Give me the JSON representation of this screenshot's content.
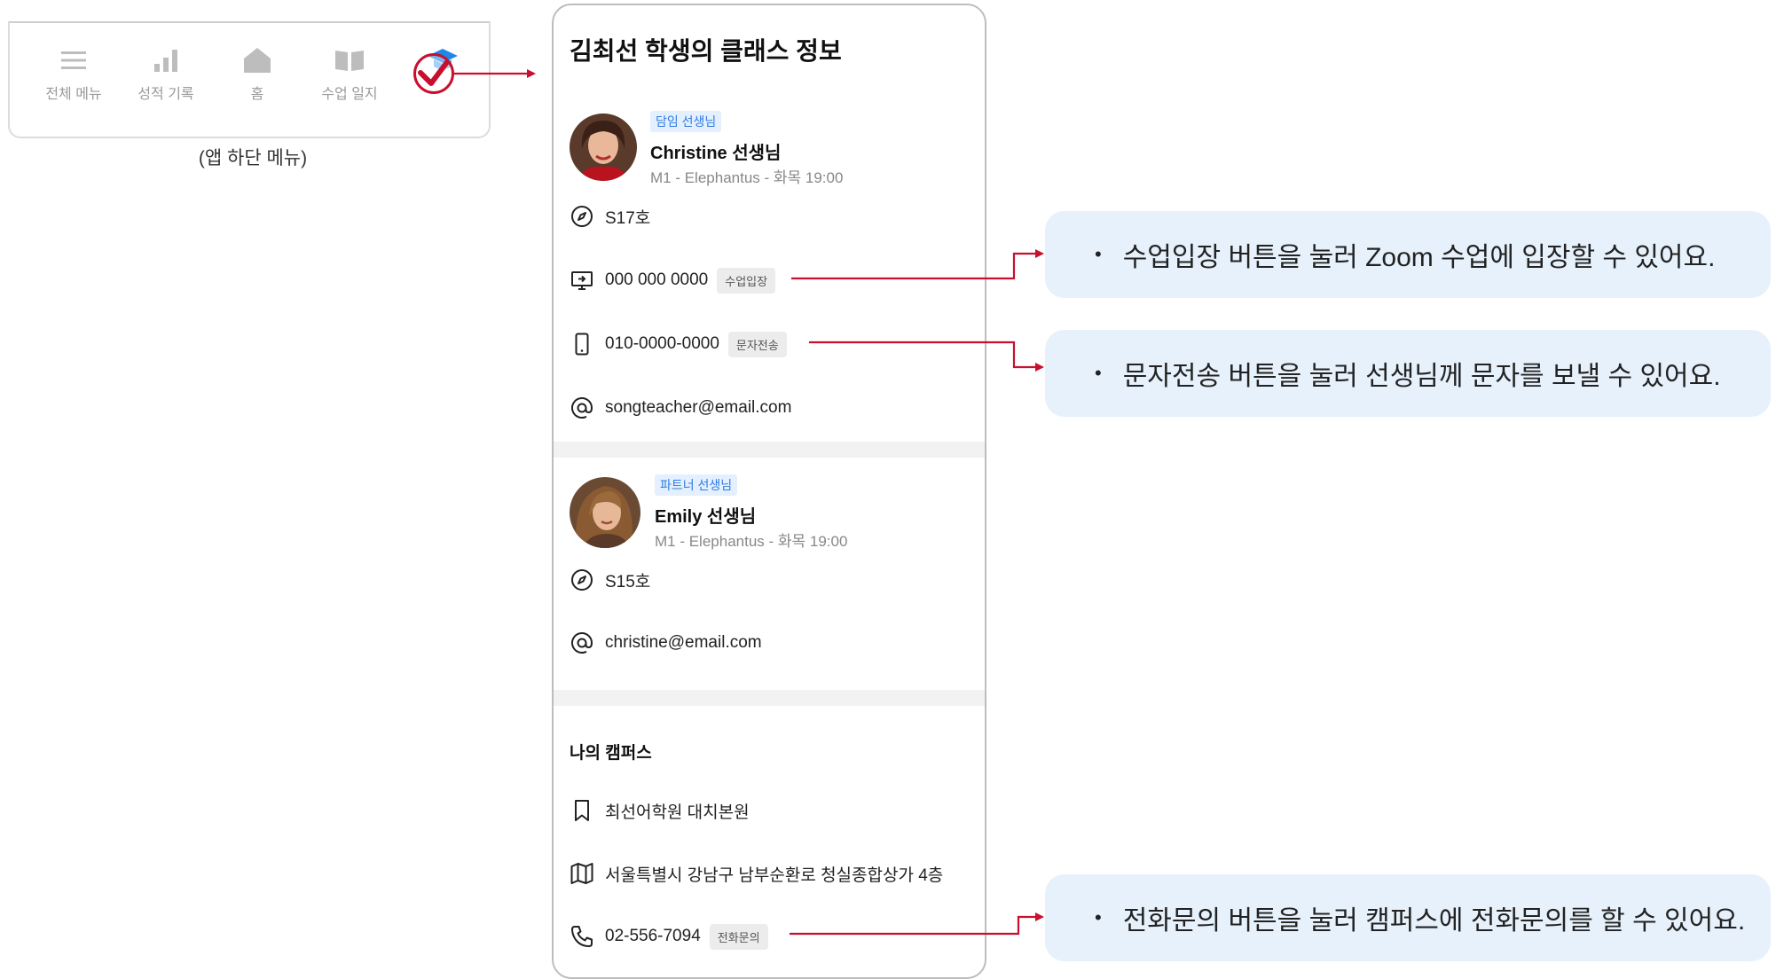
{
  "nav": {
    "items": [
      {
        "label": "전체 메뉴",
        "icon": "hamburger-menu-icon"
      },
      {
        "label": "성적 기록",
        "icon": "bar-chart-icon"
      },
      {
        "label": "홈",
        "icon": "home-icon"
      },
      {
        "label": "수업 일지",
        "icon": "open-book-icon"
      },
      {
        "label": "",
        "icon": "graduation-cap-icon"
      }
    ],
    "caption": "(앱 하단 메뉴)"
  },
  "panel": {
    "title": "김최선 학생의 클래스 정보",
    "teachers": [
      {
        "tag": "담임 선생님",
        "name": "Christine 선생님",
        "class": "M1 - Elephantus - 화목 19:00",
        "room": "S17호",
        "zoom": "000 000 0000",
        "zoom_button": "수업입장",
        "phone": "010-0000-0000",
        "sms_button": "문자전송",
        "email": "songteacher@email.com"
      },
      {
        "tag": "파트너 선생님",
        "name": "Emily 선생님",
        "class": "M1 - Elephantus - 화목 19:00",
        "room": "S15호",
        "email": "christine@email.com"
      }
    ],
    "campus": {
      "heading": "나의 캠퍼스",
      "name": "최선어학원 대치본원",
      "address": "서울특별시 강남구 남부순환로 청실종합상가 4층",
      "phone": "02-556-7094",
      "call_button": "전화문의"
    }
  },
  "callouts": [
    "수업입장 버튼을 눌러 Zoom 수업에 입장할 수 있어요.",
    "문자전송 버튼을 눌러 선생님께 문자를 보낼 수 있어요.",
    "전화문의 버튼을 눌러 캠퍼스에 전화문의를 할 수 있어요."
  ],
  "colors": {
    "accent_red": "#c8102e",
    "callout_bg": "#e6f1fb",
    "tag_blue": "#2f7de0",
    "cap_blue": "#1e88e5"
  }
}
